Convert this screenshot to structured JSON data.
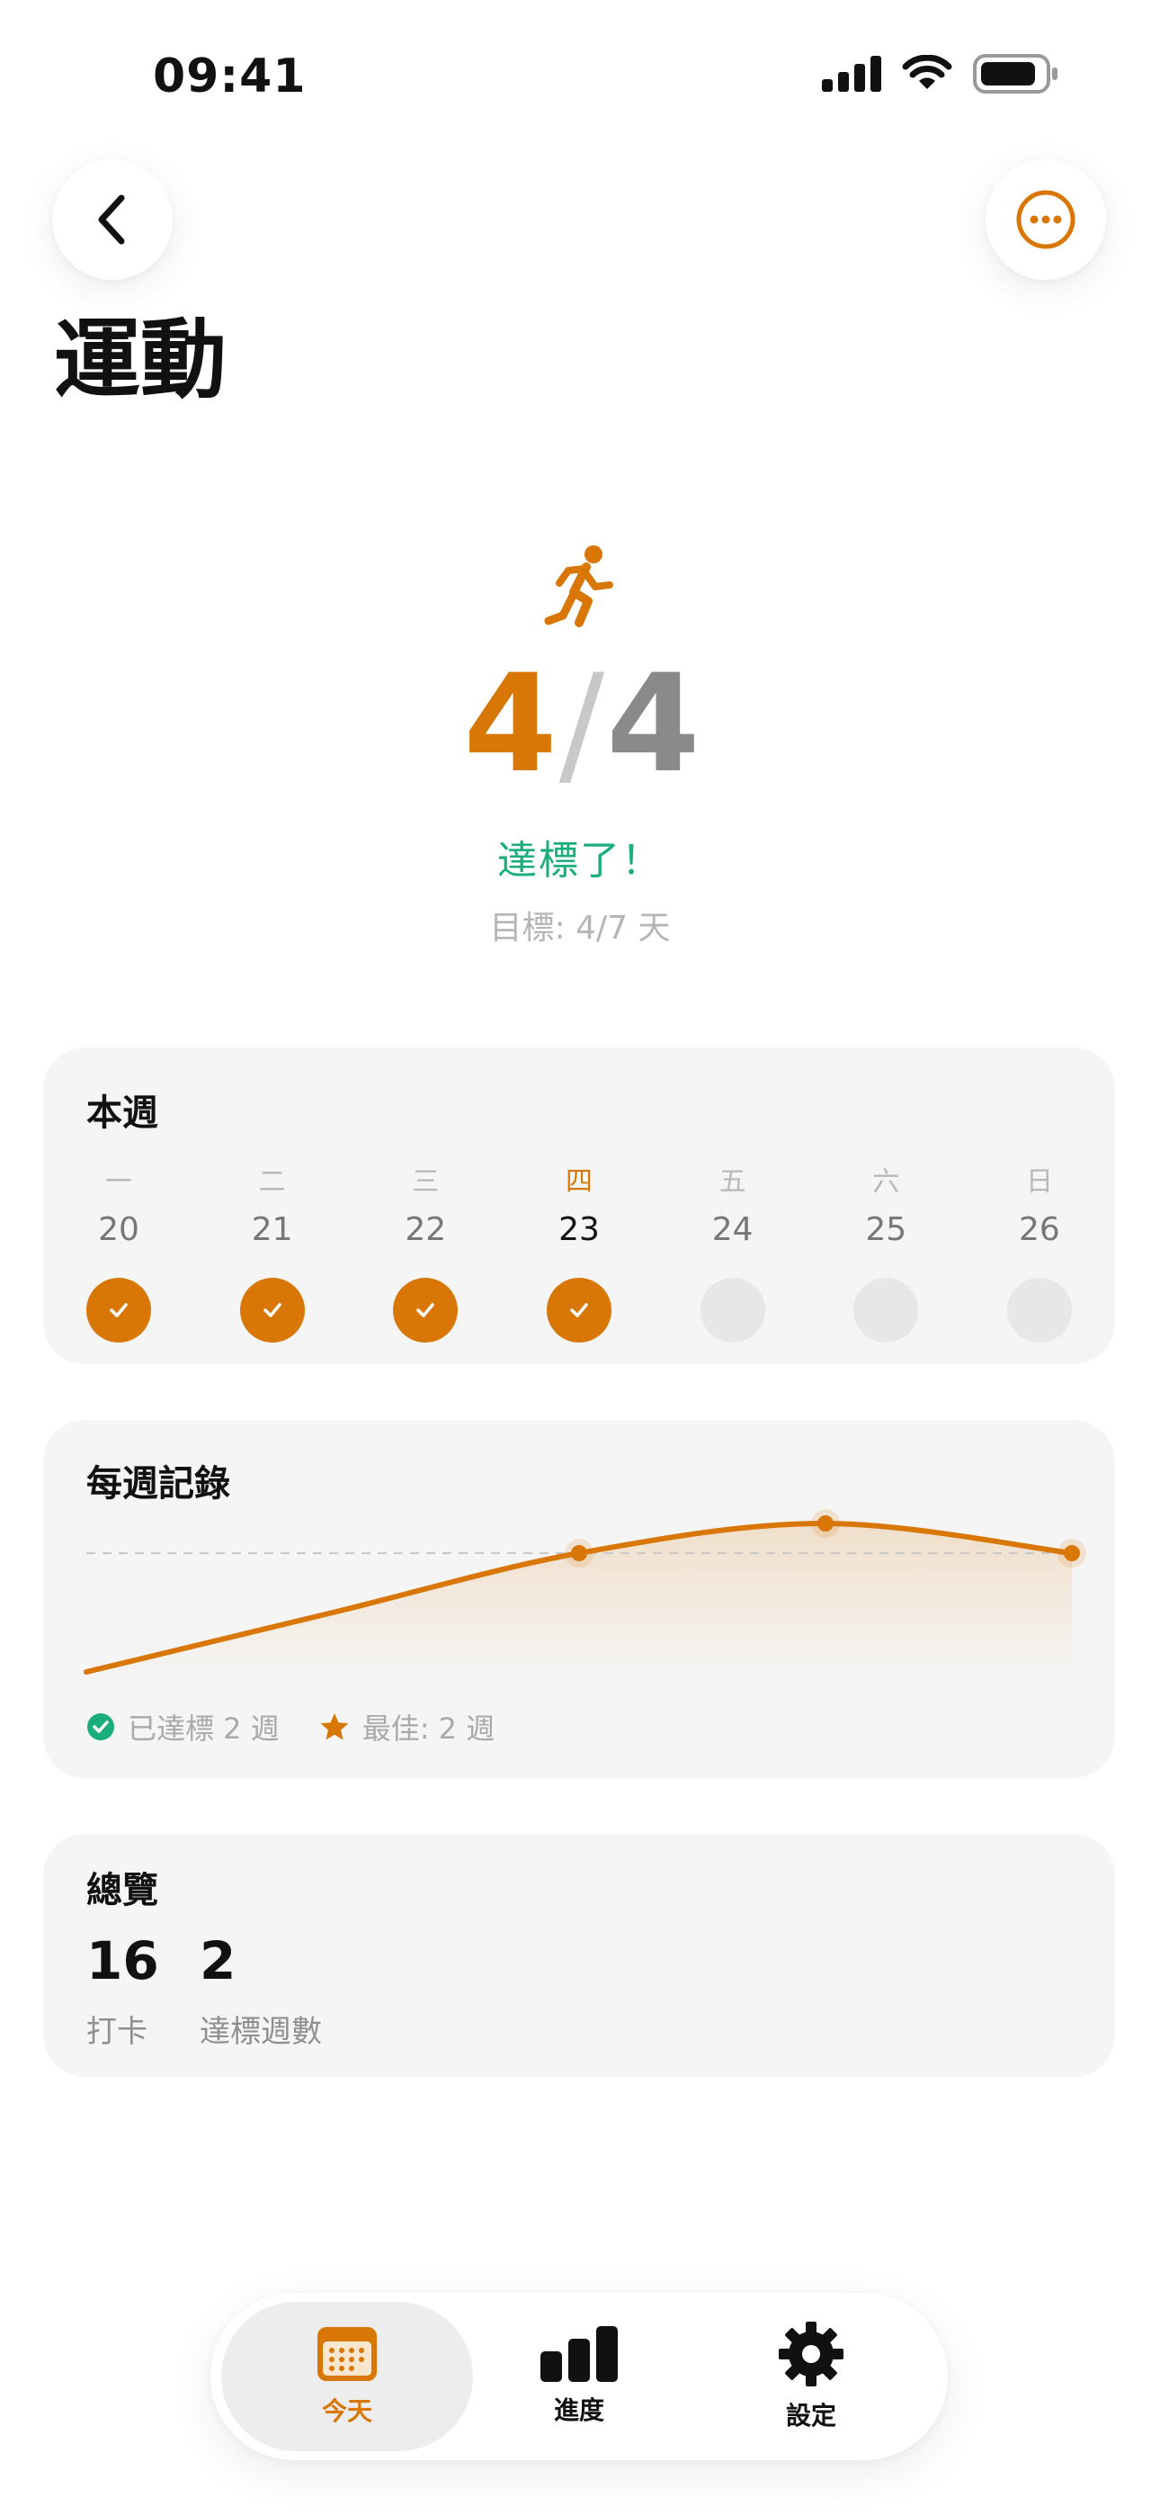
{
  "status_bar": {
    "time": "09:41"
  },
  "header": {
    "title": "運動"
  },
  "summary": {
    "completed": "4",
    "separator": "/",
    "target": "4",
    "achieved_text": "達標了！",
    "goal_text": "目標: 4/7 天"
  },
  "week": {
    "title": "本週",
    "days": [
      {
        "label": "一",
        "date": "20",
        "checked": true
      },
      {
        "label": "二",
        "date": "21",
        "checked": true
      },
      {
        "label": "三",
        "date": "22",
        "checked": true
      },
      {
        "label": "四",
        "date": "23",
        "checked": true,
        "today": true
      },
      {
        "label": "五",
        "date": "24",
        "checked": false
      },
      {
        "label": "六",
        "date": "25",
        "checked": false
      },
      {
        "label": "日",
        "date": "26",
        "checked": false
      }
    ]
  },
  "history": {
    "title": "每週記錄",
    "legend_achieved": "已達標 2 週",
    "legend_best": "最佳: 2 週"
  },
  "chart_data": {
    "type": "line",
    "series": [
      {
        "values": [
          0,
          2,
          4,
          5,
          4
        ]
      }
    ],
    "goal_line": 4,
    "marked_points": [
      2,
      3,
      4
    ],
    "grid": false
  },
  "overview": {
    "title": "總覽",
    "checkins_value": "16",
    "checkins_label": "打卡",
    "weeks_value": "2",
    "weeks_label": "達標週數"
  },
  "tabs": [
    {
      "label": "今天",
      "icon": "calendar-icon",
      "active": true
    },
    {
      "label": "進度",
      "icon": "bar-chart-icon",
      "active": false
    },
    {
      "label": "設定",
      "icon": "gear-icon",
      "active": false
    }
  ],
  "colors": {
    "accent": "#D97706",
    "success": "#1AAE7A",
    "card": "#F5F5F5"
  }
}
